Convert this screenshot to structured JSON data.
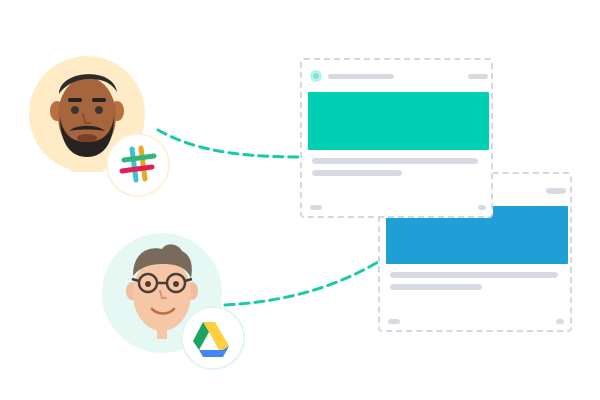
{
  "illustration": {
    "users": [
      {
        "avatar_icon": "bearded-man-avatar-icon",
        "app_icon": "slack-logo-icon",
        "avatar_background": "#ffecc7"
      },
      {
        "avatar_icon": "glasses-man-avatar-icon",
        "app_icon": "google-drive-logo-icon",
        "avatar_background": "#e5f8f4"
      }
    ],
    "cards": [
      {
        "name": "shared-message-card",
        "accent_color": "#00cfb4",
        "status_dot_color": "#7ae6cf"
      },
      {
        "name": "shared-file-card",
        "accent_color": "#209fd7"
      }
    ],
    "connector_color": "#19c9a8",
    "placeholder_color": "#d7dbe1",
    "card_border_color": "#d3d7de"
  }
}
